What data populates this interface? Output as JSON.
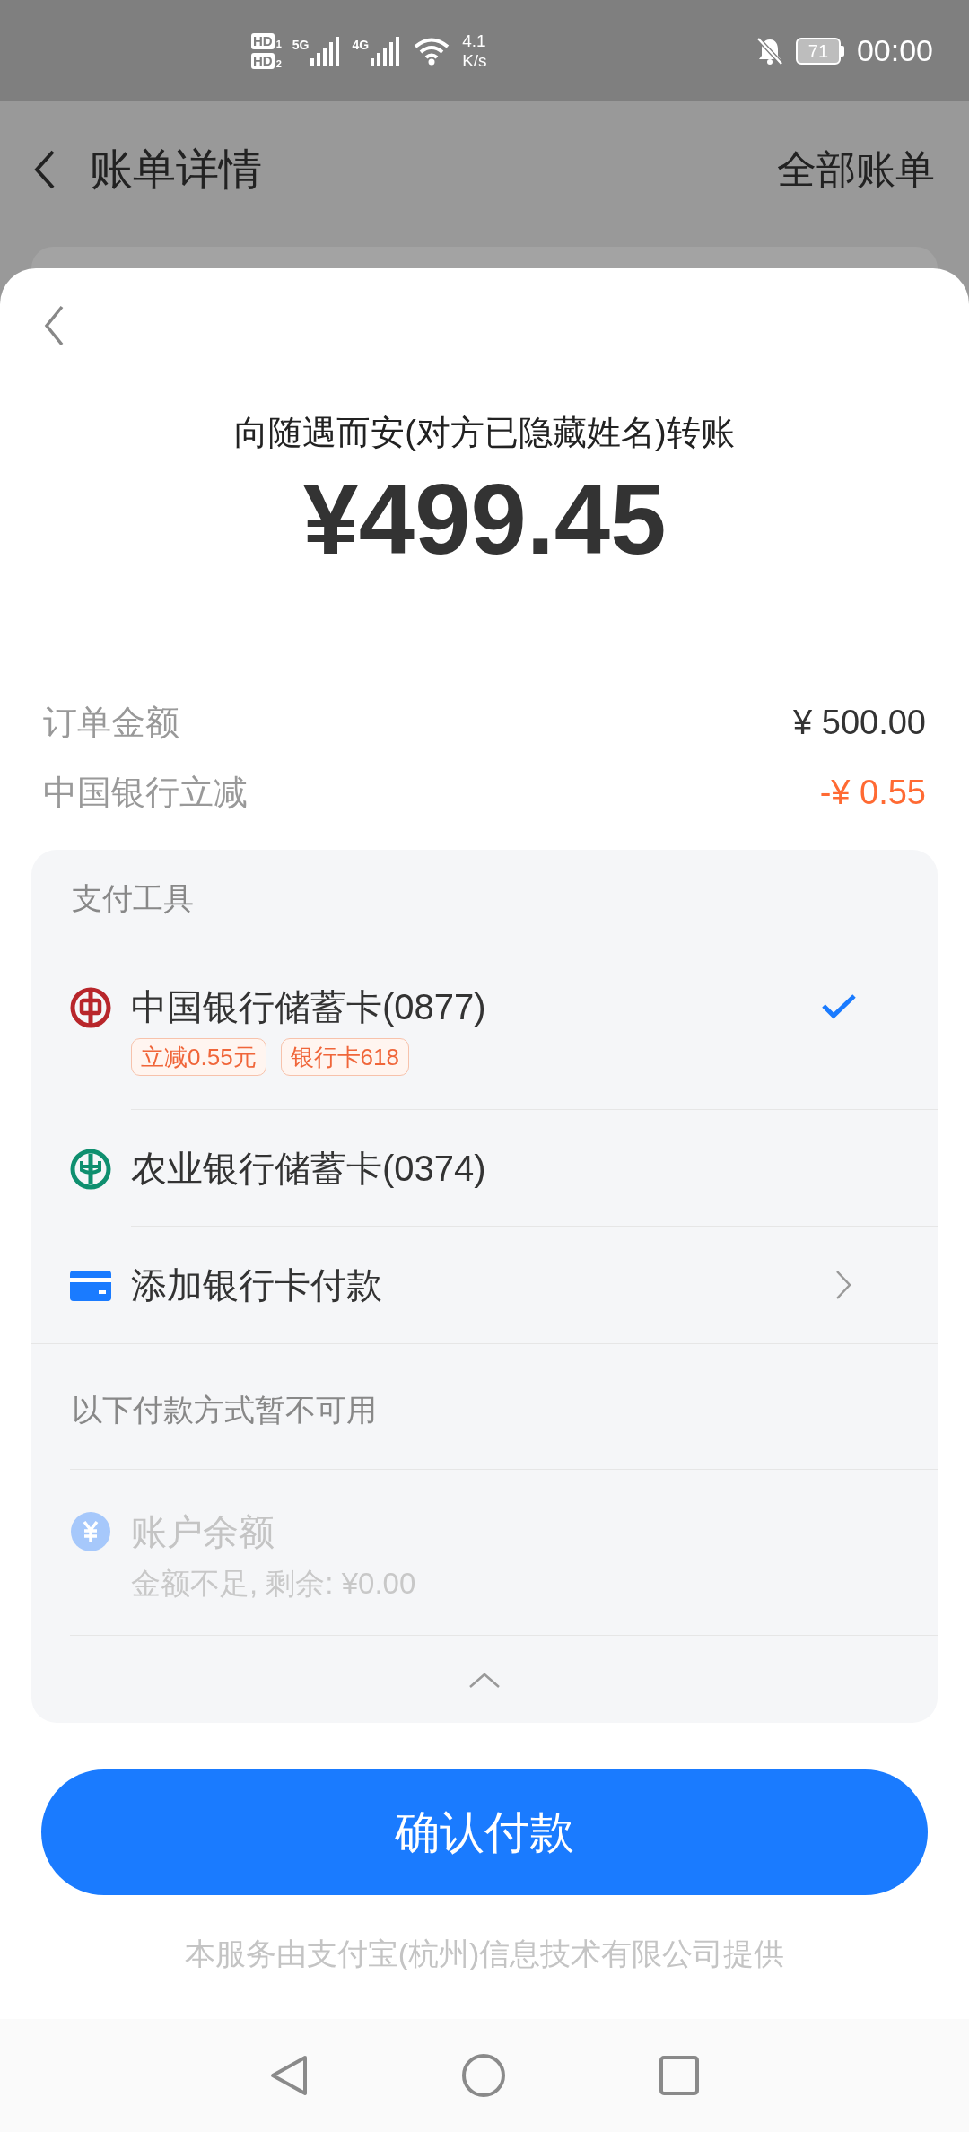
{
  "status_bar": {
    "sims": [
      {
        "badge": "HD",
        "slot": "1",
        "network": "5G"
      },
      {
        "badge": "HD",
        "slot": "2",
        "network": "4G"
      }
    ],
    "speed_value": "4.1",
    "speed_unit": "K/s",
    "battery": "71",
    "time": "00:00"
  },
  "nav": {
    "title": "账单详情",
    "action": "全部账单"
  },
  "sheet": {
    "title": "向随遇而安(对方已隐藏姓名)转账",
    "amount": "¥499.45",
    "summary": [
      {
        "label": "订单金额",
        "value": "¥ 500.00",
        "kind": "normal"
      },
      {
        "label": "中国银行立减",
        "value": "-¥ 0.55",
        "kind": "discount"
      }
    ],
    "methods_header": "支付工具",
    "methods": [
      {
        "kind": "boc",
        "name": "中国银行储蓄卡(0877)",
        "tags": [
          "立减0.55元",
          "银行卡618"
        ],
        "selected": true
      },
      {
        "kind": "abc",
        "name": "农业银行储蓄卡(0374)",
        "selected": false
      },
      {
        "kind": "add",
        "name": "添加银行卡付款"
      }
    ],
    "unavailable_header": "以下付款方式暂不可用",
    "unavailable": [
      {
        "name": "账户余额",
        "note": "金额不足, 剩余: ¥0.00",
        "disabled": true
      }
    ],
    "confirm": "确认付款",
    "footer": "本服务由支付宝(杭州)信息技术有限公司提供"
  }
}
